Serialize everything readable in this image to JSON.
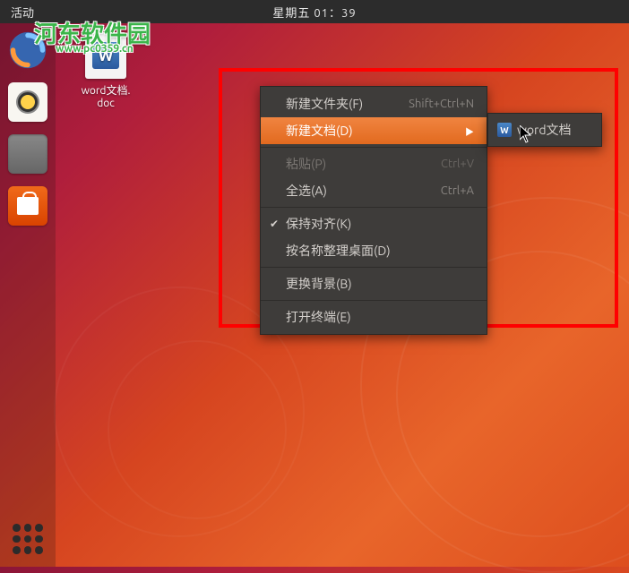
{
  "topbar": {
    "activities": "活动",
    "clock": "星期五 01：39"
  },
  "watermark": {
    "text": "河东软件园",
    "url": "www.pc0359.cn"
  },
  "desktop": {
    "file_label_line1": "word文档.",
    "file_label_line2": "doc",
    "word_glyph": "W"
  },
  "context_menu": {
    "items": [
      {
        "label": "新建文件夹(F)",
        "shortcut": "Shift+Ctrl+N",
        "has_submenu": false
      },
      {
        "label": "新建文档(D)",
        "shortcut": "",
        "has_submenu": true,
        "hover": true
      },
      {
        "label": "粘贴(P)",
        "shortcut": "Ctrl+V",
        "disabled": true
      },
      {
        "label": "全选(A)",
        "shortcut": "Ctrl+A"
      },
      {
        "label": "保持对齐(K)",
        "checked": true
      },
      {
        "label": "按名称整理桌面(D)"
      },
      {
        "label": "更换背景(B)"
      },
      {
        "label": "打开终端(E)"
      }
    ]
  },
  "submenu": {
    "items": [
      {
        "icon": "W",
        "label": "word文档"
      }
    ]
  }
}
